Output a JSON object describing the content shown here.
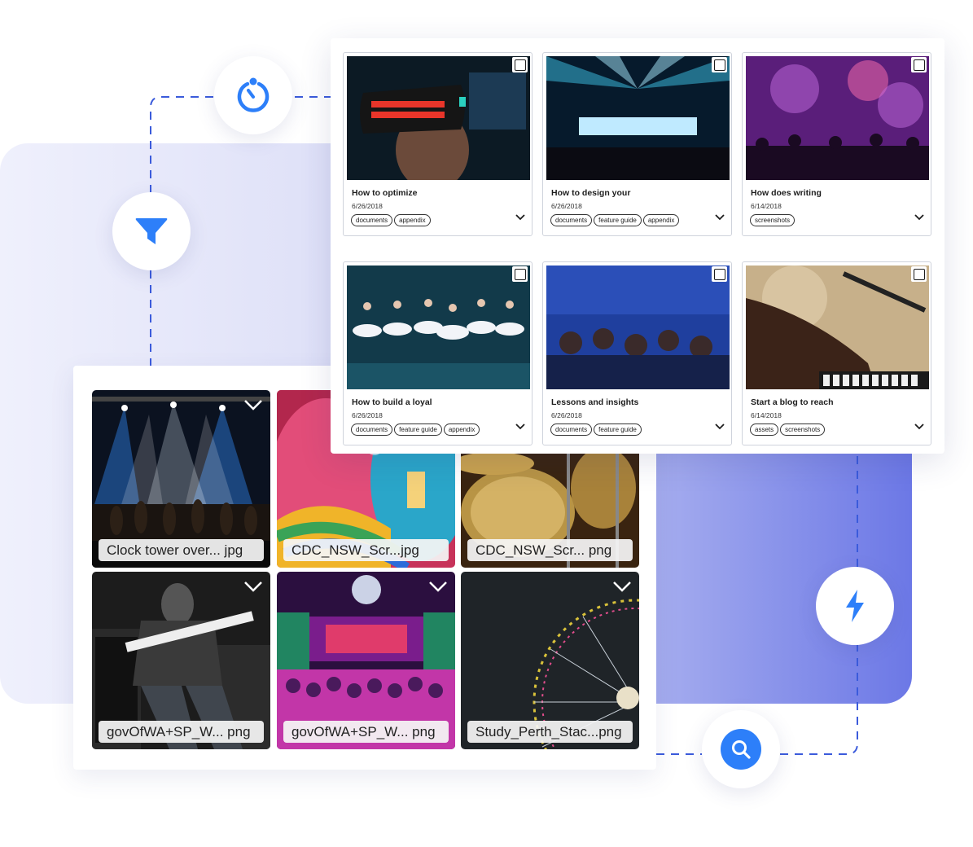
{
  "colors": {
    "accent": "#2d7ff9",
    "panel_gradient_end": "#6c78e6"
  },
  "icons": {
    "timer": "timer-icon",
    "filter": "filter-icon",
    "bolt": "lightning-bolt-icon",
    "search": "search-icon"
  },
  "thumbnails": [
    {
      "filename": "Clock tower over...  jpg"
    },
    {
      "filename": "CDC_NSW_Scr...jpg"
    },
    {
      "filename": "CDC_NSW_Scr...  png"
    },
    {
      "filename": "govOfWA+SP_W...  png"
    },
    {
      "filename": "govOfWA+SP_W...  png"
    },
    {
      "filename": "Study_Perth_Stac...png"
    }
  ],
  "cards": [
    {
      "title": "How to optimize",
      "date": "6/26/2018",
      "tags": [
        "documents",
        "appendix"
      ]
    },
    {
      "title": "How to design your",
      "date": "6/26/2018",
      "tags": [
        "documents",
        "feature guide",
        "appendix"
      ]
    },
    {
      "title": "How does writing",
      "date": "6/14/2018",
      "tags": [
        "screenshots"
      ]
    },
    {
      "title": "How to build a loyal",
      "date": "6/26/2018",
      "tags": [
        "documents",
        "feature guide",
        "appendix"
      ]
    },
    {
      "title": "Lessons and insights",
      "date": "6/26/2018",
      "tags": [
        "documents",
        "feature guide"
      ]
    },
    {
      "title": "Start a blog to reach",
      "date": "6/14/2018",
      "tags": [
        "assets",
        "screenshots"
      ]
    }
  ]
}
